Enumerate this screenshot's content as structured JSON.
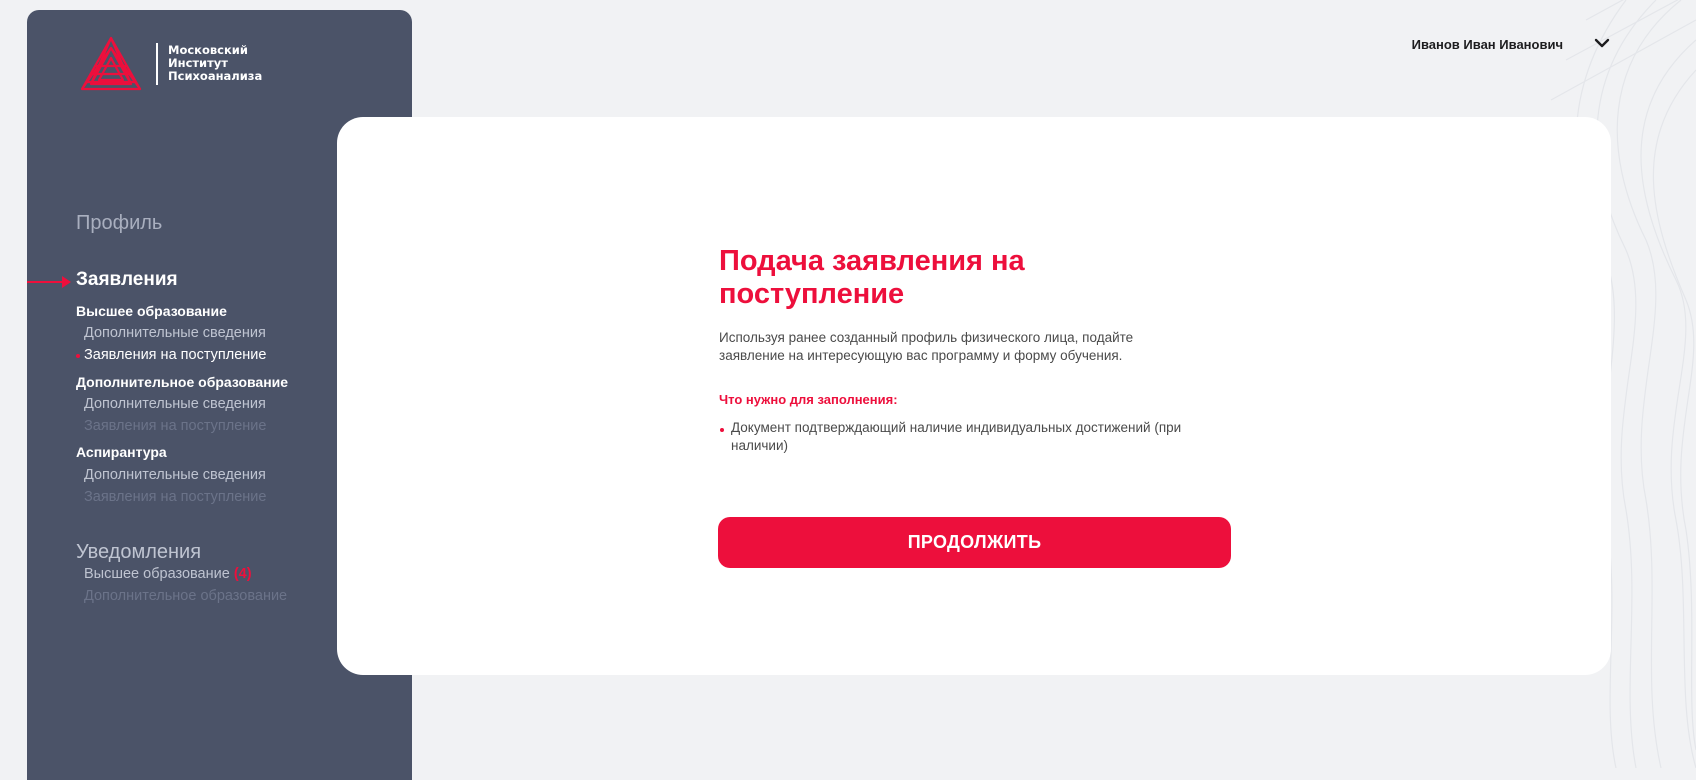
{
  "colors": {
    "accent": "#ed0f3c",
    "sidebar_bg": "#4b5368",
    "page_bg": "#f1f2f4",
    "card_bg": "#ffffff"
  },
  "logo": {
    "line1": "Московский",
    "line2": "Институт",
    "line3": "Психоанализа",
    "icon": "triangle-logo-icon"
  },
  "user": {
    "name": "Иванов Иван Иванович",
    "dropdown_icon": "chevron-down-icon"
  },
  "sidebar": {
    "profile": "Профиль",
    "applications": "Заявления",
    "higher_education": {
      "title": "Высшее образование",
      "additional_info": "Дополнительные сведения",
      "admission_applications": "Заявления на поступление"
    },
    "additional_education": {
      "title": "Дополнительное образование",
      "additional_info": "Дополнительные сведения",
      "admission_applications": "Заявления на поступление"
    },
    "postgraduate": {
      "title": "Аспирантура",
      "additional_info": "Дополнительные сведения",
      "admission_applications": "Заявления на поступление"
    },
    "notifications": {
      "title": "Уведомления",
      "higher_education": "Высшее образование",
      "higher_education_badge": "(4)",
      "additional_education": "Дополнительное образование"
    }
  },
  "main": {
    "title": "Подача заявления на поступление",
    "description": "Используя ранее созданный профиль физического лица, подайте заявление на интересующую вас программу и форму обучения.",
    "requirements_title": "Что нужно для заполнения:",
    "requirements": [
      "Документ подтверждающий наличие индивидуальных достижений (при наличии)"
    ],
    "continue_label": "ПРОДОЛЖИТЬ"
  }
}
